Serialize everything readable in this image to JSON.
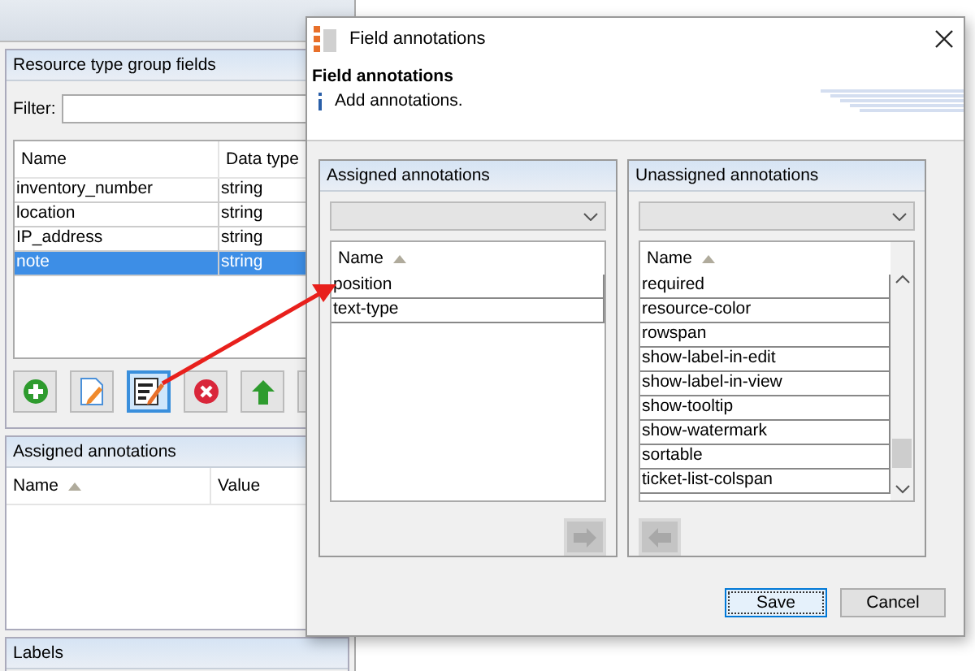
{
  "background_window": {
    "fields_panel": {
      "title": "Resource type group fields",
      "filter_label": "Filter:",
      "columns": [
        "Name",
        "Data type"
      ],
      "rows": [
        {
          "name": "inventory_number",
          "data_type": "string",
          "selected": false
        },
        {
          "name": "location",
          "data_type": "string",
          "selected": false
        },
        {
          "name": "IP_address",
          "data_type": "string",
          "selected": false
        },
        {
          "name": "note",
          "data_type": "string",
          "selected": true
        }
      ]
    },
    "toolbar": [
      {
        "kind": "add",
        "selected": false
      },
      {
        "kind": "edit",
        "selected": false
      },
      {
        "kind": "annotate",
        "selected": true
      },
      {
        "kind": "delete",
        "selected": false
      },
      {
        "kind": "up",
        "selected": false
      },
      {
        "selected": false
      }
    ],
    "annotations_panel": {
      "title": "Assigned annotations",
      "columns": [
        {
          "label": "Name",
          "sorted": true
        },
        {
          "label": "Value",
          "sorted": false
        }
      ]
    },
    "labels_panel": {
      "title": "Labels"
    }
  },
  "dialog": {
    "title": "Field annotations",
    "heading": "Field annotations",
    "info": "Add annotations.",
    "lists": [
      {
        "title": "Assigned annotations",
        "kind": "assigned",
        "column": "Name",
        "items": [
          "position",
          "text-type"
        ]
      },
      {
        "title": "Unassigned annotations",
        "kind": "unassigned",
        "column": "Name",
        "items": [
          "required",
          "resource-color",
          "rowspan",
          "show-label-in-edit",
          "show-label-in-view",
          "show-tooltip",
          "show-watermark",
          "sortable",
          "ticket-list-colspan"
        ]
      }
    ],
    "buttons": [
      {
        "label": "Save",
        "default": true
      },
      {
        "label": "Cancel",
        "default": false
      }
    ]
  }
}
